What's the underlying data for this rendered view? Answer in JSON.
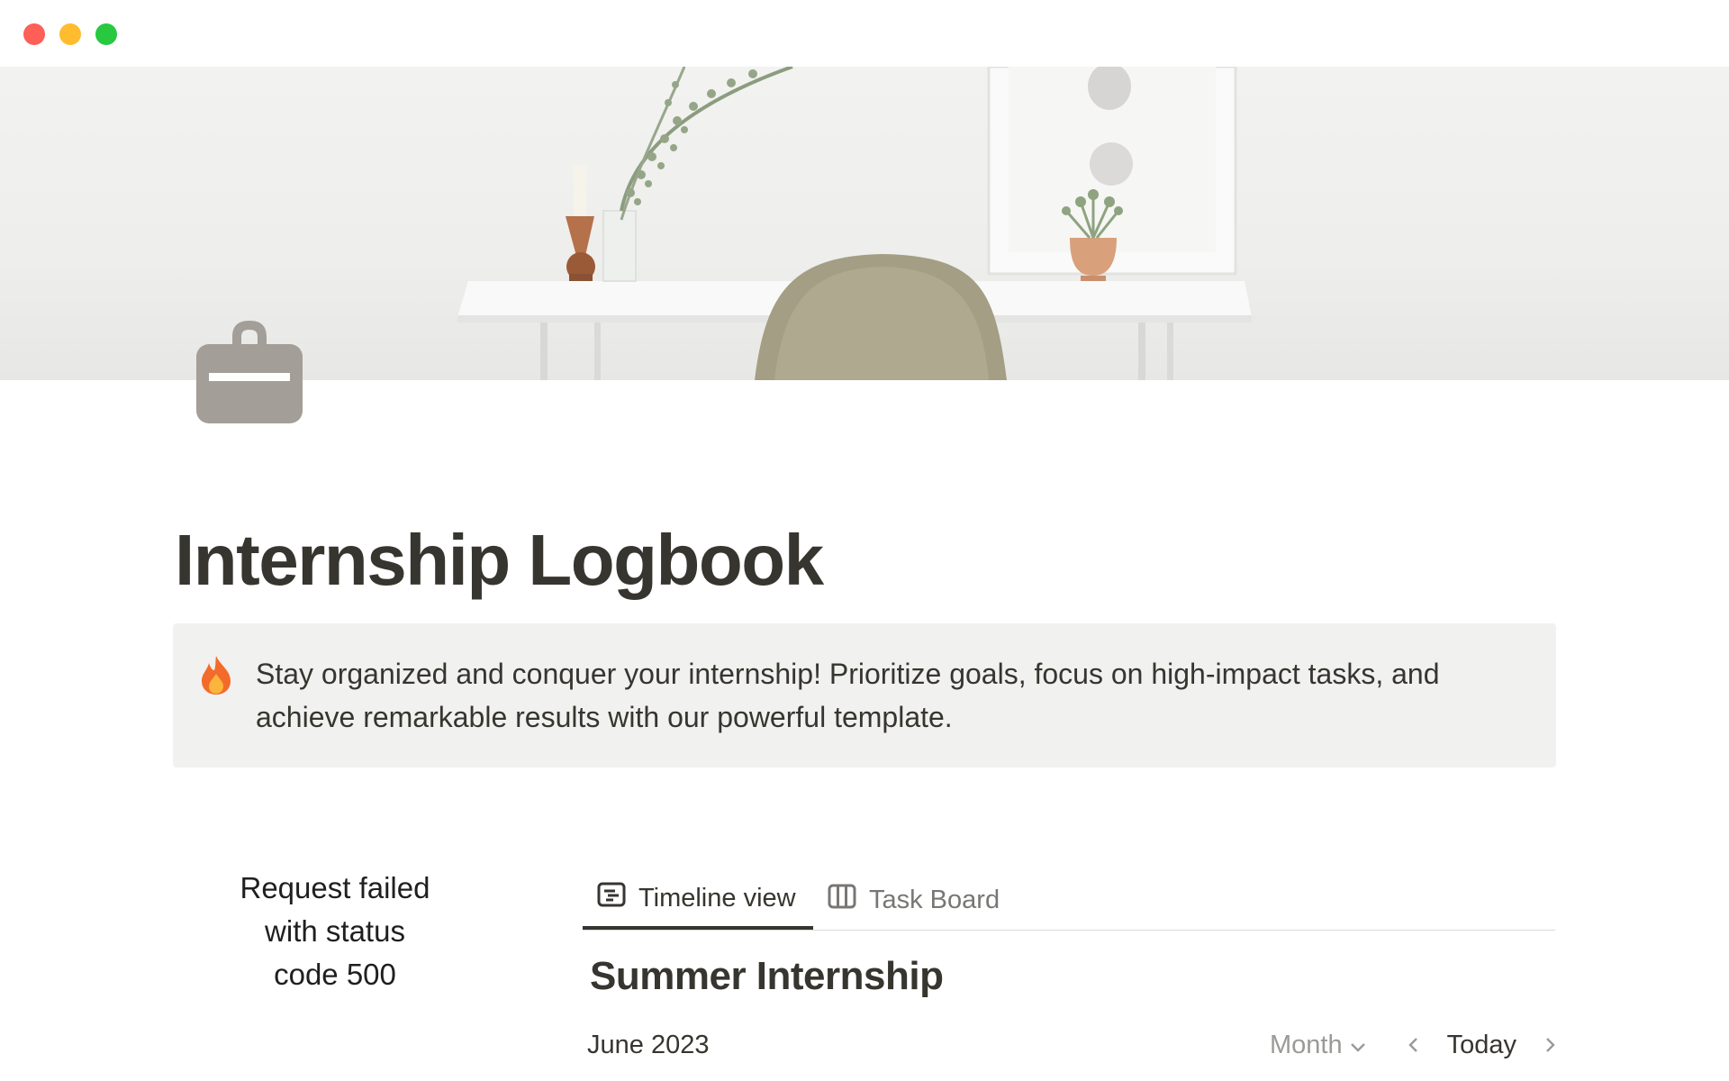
{
  "window": {
    "controls": [
      "close",
      "minimize",
      "maximize"
    ]
  },
  "cover": {
    "icons": [
      "desk-scene"
    ]
  },
  "page": {
    "icon": "briefcase-icon",
    "title": "Internship Logbook"
  },
  "callout": {
    "icon": "fire-emoji",
    "text": "Stay organized and conquer your internship! Prioritize goals, focus on high-impact tasks, and achieve remarkable results with our powerful template."
  },
  "embed_error": {
    "text": "Request failed with status code 500"
  },
  "database": {
    "tabs": [
      {
        "label": "Timeline view",
        "icon": "timeline-icon",
        "active": true
      },
      {
        "label": "Task Board",
        "icon": "board-icon",
        "active": false
      }
    ],
    "title": "Summer Internship",
    "calendar": {
      "month": "June 2023",
      "view_select": "Month",
      "today_label": "Today"
    }
  },
  "colors": {
    "text": "#37352f",
    "muted": "#787774",
    "callout_bg": "#f1f1ef",
    "icon_gray": "#a39e97"
  }
}
